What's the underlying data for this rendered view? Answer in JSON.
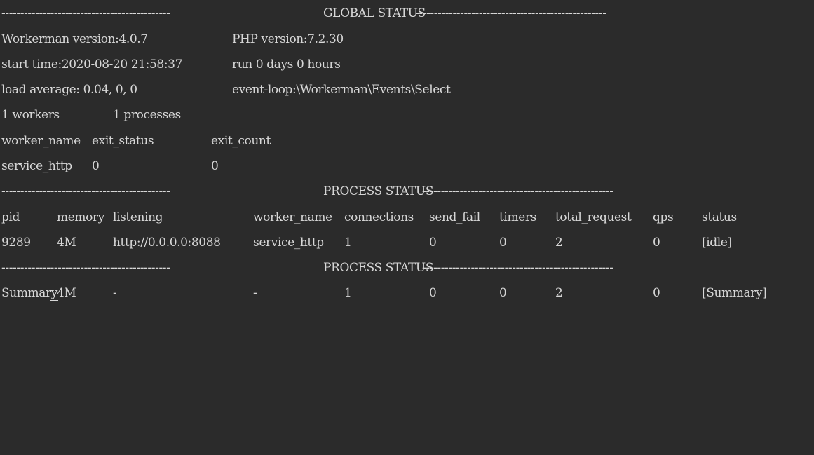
{
  "global_status": {
    "title": "GLOBAL STATUS",
    "dashes_left": "---------------------------------------------",
    "dashes_right": "---------------------------------------------------"
  },
  "info": {
    "workerman_version": "Workerman version:4.0.7",
    "php_version": "PHP version:7.2.30",
    "start_time": "start time:2020-08-20 21:58:37",
    "run_time": "run 0 days 0 hours",
    "load_average": "load average: 0.04, 0, 0",
    "event_loop": "event-loop:\\Workerman\\Events\\Select",
    "workers": "1 workers",
    "processes": "1 processes"
  },
  "worker_table": {
    "headers": [
      "worker_name",
      "exit_status",
      "exit_count"
    ],
    "rows": [
      [
        "service_http",
        "0",
        "0"
      ]
    ]
  },
  "process_status": {
    "title": "PROCESS STATUS",
    "dashes_left": "---------------------------------------------",
    "dashes_right": "---------------------------------------------------"
  },
  "process_table": {
    "headers": [
      "pid",
      "memory",
      "listening",
      "worker_name",
      "connections",
      "send_fail",
      "timers",
      "total_request",
      "qps",
      "status"
    ],
    "rows": [
      [
        "9289",
        "4M",
        "http://0.0.0.0:8088",
        "service_http",
        "1",
        "0",
        "0",
        "2",
        "0",
        "[idle]"
      ]
    ]
  },
  "process_status_2": {
    "title": "PROCESS STATUS",
    "dashes_left": "---------------------------------------------",
    "dashes_right": "---------------------------------------------------"
  },
  "summary_row": [
    "Summary",
    "4M",
    "-",
    "-",
    "1",
    "0",
    "0",
    "2",
    "0",
    "[Summary]"
  ]
}
